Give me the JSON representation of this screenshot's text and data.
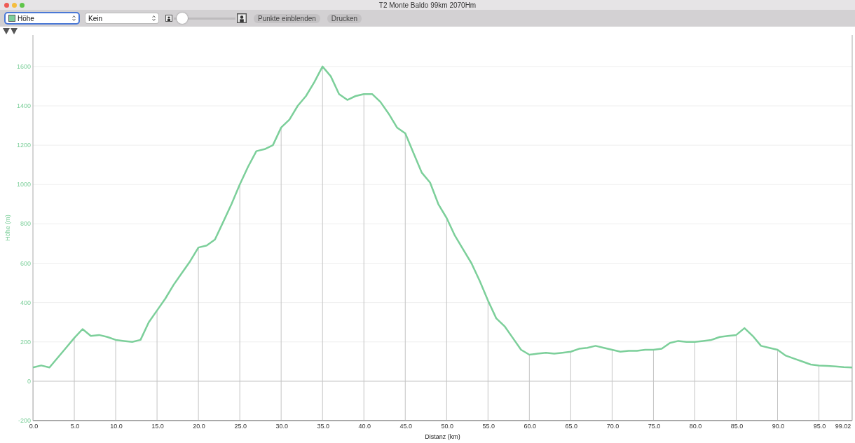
{
  "window": {
    "title": "T2 Monte Baldo 99km 2070Hm"
  },
  "toolbar": {
    "y_select": {
      "focused": true
    },
    "x_select": {
      "value": "Kein",
      "focused": false
    },
    "zoom_slider": {
      "level": 0.05
    },
    "buttons": [
      "Punkte einblenden",
      "Drucken"
    ]
  },
  "chart": {
    "chart_data": {
      "type": "line",
      "grid": true,
      "xlabel": "Distanz (km)",
      "ylabel": "Höhe (m)",
      "xlim": [
        0,
        99.02
      ],
      "ylim": [
        -200,
        1760
      ],
      "xticks": [
        {
          "value": 0,
          "label": "0.0"
        },
        {
          "value": 5,
          "label": "5.0"
        },
        {
          "value": 10,
          "label": "10.0"
        },
        {
          "value": 15,
          "label": "15.0"
        },
        {
          "value": 20,
          "label": "20.0"
        },
        {
          "value": 25,
          "label": "25.0"
        },
        {
          "value": 30,
          "label": "30.0"
        },
        {
          "value": 35,
          "label": "35.0"
        },
        {
          "value": 40,
          "label": "40.0"
        },
        {
          "value": 45,
          "label": "45.0"
        },
        {
          "value": 50,
          "label": "50.0"
        },
        {
          "value": 55,
          "label": "55.0"
        },
        {
          "value": 60,
          "label": "60.0"
        },
        {
          "value": 65,
          "label": "65.0"
        },
        {
          "value": 70,
          "label": "70.0"
        },
        {
          "value": 75,
          "label": "75.0"
        },
        {
          "value": 80,
          "label": "80.0"
        },
        {
          "value": 85,
          "label": "85.0"
        },
        {
          "value": 90,
          "label": "90.0"
        },
        {
          "value": 95,
          "label": "95.0"
        },
        {
          "value": 99.02,
          "label": "99.02"
        }
      ],
      "yticks": [
        -200,
        0,
        200,
        400,
        600,
        800,
        1000,
        1200,
        1400,
        1600
      ],
      "x": [
        0,
        1,
        2,
        3,
        4,
        5,
        6,
        7,
        8,
        9,
        10,
        11,
        12,
        13,
        14,
        15,
        16,
        17,
        18,
        19,
        20,
        21,
        22,
        23,
        24,
        25,
        26,
        27,
        28,
        29,
        30,
        31,
        32,
        33,
        34,
        35,
        36,
        37,
        38,
        39,
        40,
        41,
        42,
        43,
        44,
        45,
        46,
        47,
        48,
        49,
        50,
        51,
        52,
        53,
        54,
        55,
        56,
        57,
        58,
        59,
        60,
        61,
        62,
        63,
        64,
        65,
        66,
        67,
        68,
        69,
        70,
        71,
        72,
        73,
        74,
        75,
        76,
        77,
        78,
        79,
        80,
        81,
        82,
        83,
        84,
        85,
        86,
        87,
        88,
        89,
        90,
        91,
        92,
        93,
        94,
        95,
        96,
        97,
        98,
        99.02
      ],
      "series": [
        {
          "name": "Höhe",
          "color": "#7ccf9a",
          "values": [
            70,
            80,
            70,
            120,
            170,
            220,
            265,
            230,
            235,
            225,
            210,
            205,
            200,
            210,
            300,
            360,
            420,
            490,
            550,
            610,
            680,
            690,
            720,
            810,
            900,
            1000,
            1090,
            1170,
            1180,
            1200,
            1290,
            1330,
            1400,
            1450,
            1520,
            1600,
            1550,
            1460,
            1430,
            1450,
            1460,
            1460,
            1420,
            1360,
            1290,
            1260,
            1160,
            1060,
            1010,
            900,
            830,
            740,
            670,
            600,
            510,
            410,
            320,
            280,
            220,
            160,
            135,
            140,
            145,
            140,
            145,
            150,
            165,
            170,
            180,
            170,
            160,
            150,
            155,
            155,
            160,
            160,
            165,
            195,
            205,
            200,
            200,
            205,
            210,
            225,
            230,
            235,
            270,
            230,
            180,
            170,
            160,
            130,
            115,
            100,
            85,
            80,
            78,
            75,
            72,
            70
          ]
        }
      ]
    }
  }
}
